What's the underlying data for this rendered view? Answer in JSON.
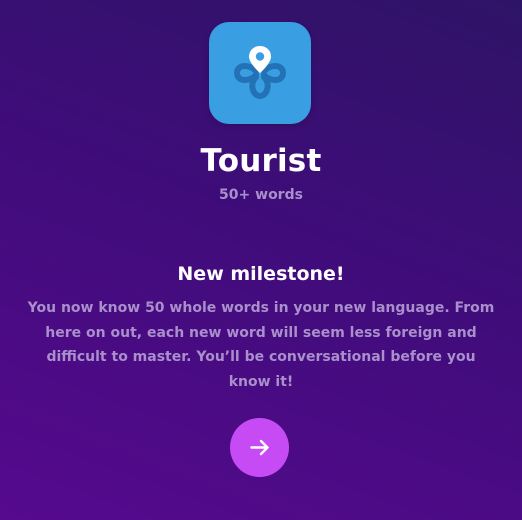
{
  "badge": {
    "icon": "location-pin-loop-icon",
    "background_color": "#3a9ee3"
  },
  "level": {
    "title": "Tourist",
    "subtitle": "50+ words"
  },
  "milestone": {
    "heading": "New milestone!",
    "message": "You now know 50 whole words in your new language. From here on out, each new word will seem less foreign and difficult to master. You’ll be conversational before you know it!"
  },
  "next_button": {
    "icon": "arrow-right-icon",
    "color": "#c64bf5"
  },
  "colors": {
    "text_primary": "#ffffff",
    "text_muted": "#a98fcb"
  }
}
